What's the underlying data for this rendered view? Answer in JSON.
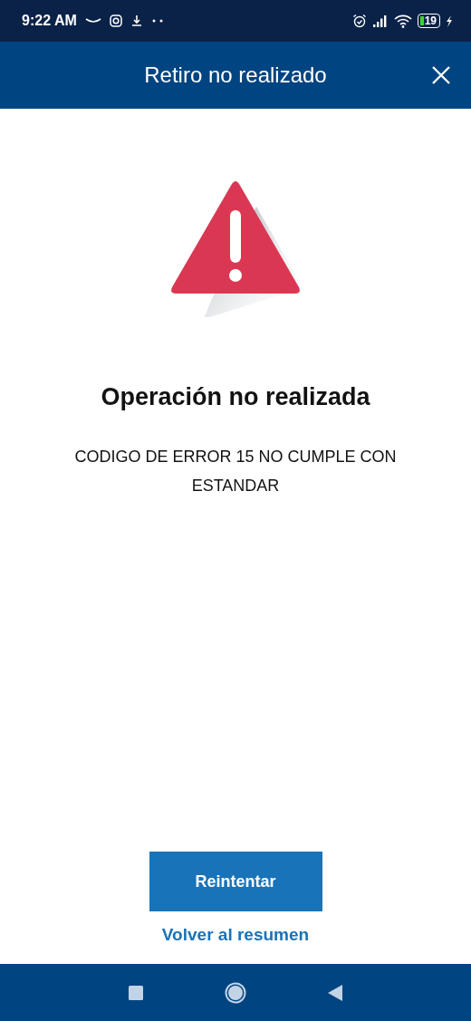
{
  "status_bar": {
    "time": "9:22 AM",
    "battery": "19"
  },
  "header": {
    "title": "Retiro no realizado"
  },
  "result": {
    "title": "Operación no realizada",
    "message": "CODIGO DE ERROR 15 NO CUMPLE CON ESTANDAR"
  },
  "actions": {
    "primary": "Reintentar",
    "secondary": "Volver al resumen"
  }
}
